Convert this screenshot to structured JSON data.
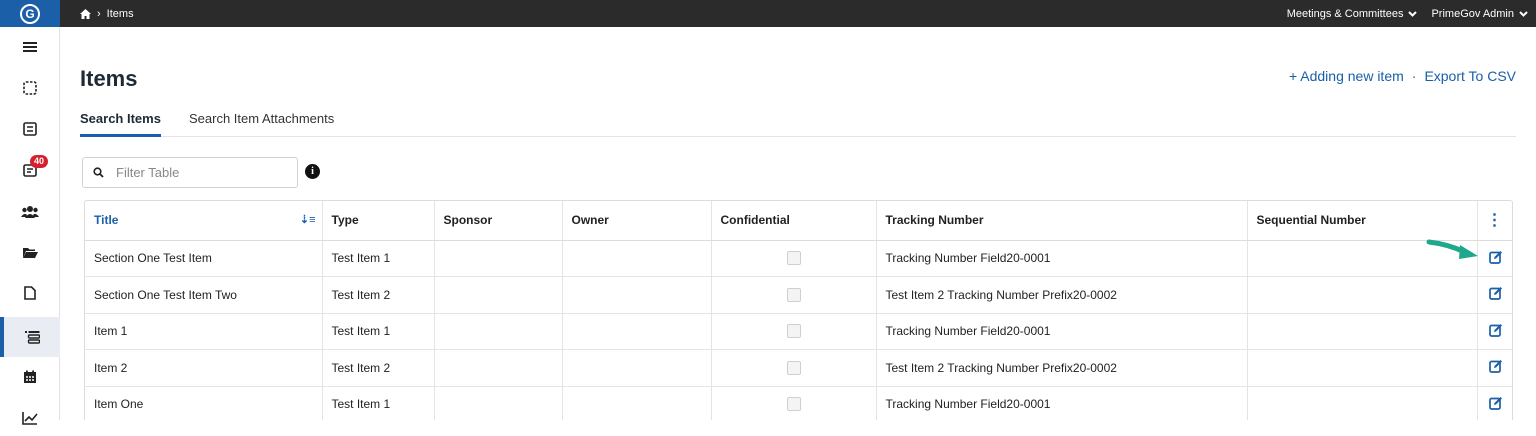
{
  "topbar": {
    "logo": "G",
    "breadcrumb": "Items",
    "meetings_menu": "Meetings & Committees",
    "user_menu": "PrimeGov Admin"
  },
  "sidebar": {
    "badge_count": "40",
    "items": [
      "menu-icon",
      "selection-icon",
      "agenda-icon",
      "inbox-icon",
      "users-icon",
      "folder-icon",
      "document-icon",
      "items-list-icon",
      "calendar-icon",
      "chart-icon"
    ]
  },
  "page": {
    "title": "Items",
    "add_new": "+ Adding new item",
    "separator": "·",
    "export": "Export To CSV"
  },
  "tabs": {
    "search_items": "Search Items",
    "search_attachments": "Search Item Attachments"
  },
  "filter": {
    "placeholder": "Filter Table"
  },
  "table": {
    "headers": {
      "title": "Title",
      "type": "Type",
      "sponsor": "Sponsor",
      "owner": "Owner",
      "confidential": "Confidential",
      "tracking": "Tracking Number",
      "sequential": "Sequential Number"
    },
    "rows": [
      {
        "title": "Section One Test Item",
        "type": "Test Item 1",
        "sponsor": "",
        "owner": "",
        "tracking": "Tracking Number Field20-0001",
        "sequential": ""
      },
      {
        "title": "Section One Test Item Two",
        "type": "Test Item 2",
        "sponsor": "",
        "owner": "",
        "tracking": "Test Item 2 Tracking Number Prefix20-0002",
        "sequential": ""
      },
      {
        "title": "Item 1",
        "type": "Test Item 1",
        "sponsor": "",
        "owner": "",
        "tracking": "Tracking Number Field20-0001",
        "sequential": ""
      },
      {
        "title": "Item 2",
        "type": "Test Item 2",
        "sponsor": "",
        "owner": "",
        "tracking": "Test Item 2 Tracking Number Prefix20-0002",
        "sequential": ""
      },
      {
        "title": "Item One",
        "type": "Test Item 1",
        "sponsor": "",
        "owner": "",
        "tracking": "Tracking Number Field20-0001",
        "sequential": ""
      }
    ]
  },
  "colors": {
    "accent": "#1a5fa8",
    "topbar": "#2b2b2b",
    "badge": "#d6202e",
    "arrow": "#1fa98c"
  }
}
